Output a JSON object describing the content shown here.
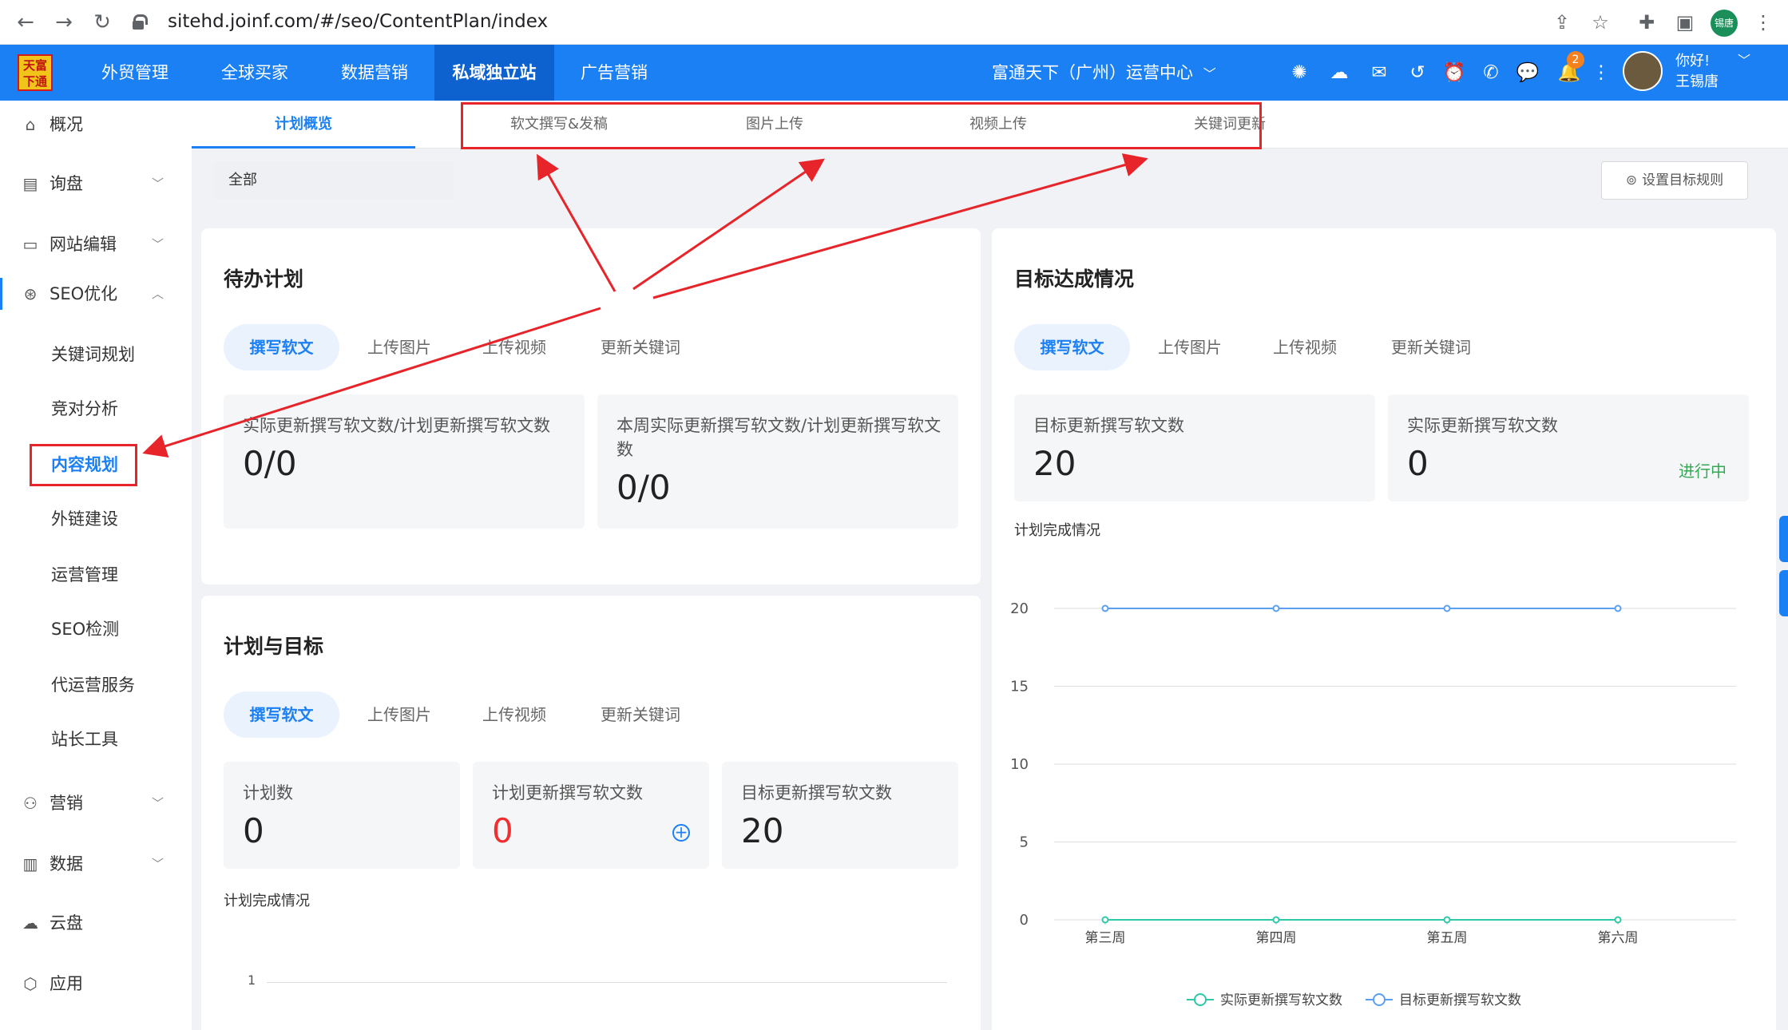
{
  "browser": {
    "url": "sitehd.joinf.com/#/seo/ContentPlan/index",
    "profile": "锡唐"
  },
  "header": {
    "logo_text": "天富下通",
    "nav": [
      "外贸管理",
      "全球买家",
      "数据营销",
      "私域独立站",
      "广告营销"
    ],
    "active_nav": "私域独立站",
    "org": "富通天下（广州）运营中心",
    "notification_count": "2",
    "greeting": "你好!",
    "user_name": "王锡唐"
  },
  "sidebar": {
    "items": [
      {
        "label": "概况",
        "icon": "home-icon"
      },
      {
        "label": "询盘",
        "icon": "clipboard-icon"
      },
      {
        "label": "网站编辑",
        "icon": "monitor-icon"
      },
      {
        "label": "SEO优化",
        "icon": "search-chart-icon"
      },
      {
        "label": "营销",
        "icon": "users-icon"
      },
      {
        "label": "数据",
        "icon": "bar-chart-icon"
      },
      {
        "label": "云盘",
        "icon": "cloud-icon"
      },
      {
        "label": "应用",
        "icon": "hexagon-icon"
      }
    ],
    "seo_sub": [
      "关键词规划",
      "竞对分析",
      "内容规划",
      "外链建设",
      "运营管理",
      "SEO检测",
      "代运营服务",
      "站长工具"
    ],
    "active_sub": "内容规划"
  },
  "sub_tabs": [
    "计划概览",
    "软文撰写&发稿",
    "图片上传",
    "视频上传",
    "关键词更新"
  ],
  "active_sub_tab": "计划概览",
  "filter": {
    "value": "全部"
  },
  "rule_button": "设置目标规则",
  "pending_plan": {
    "title": "待办计划",
    "tabs": [
      "撰写软文",
      "上传图片",
      "上传视频",
      "更新关键词"
    ],
    "stats": [
      {
        "label": "实际更新撰写软文数/计划更新撰写软文数",
        "value": "0/0"
      },
      {
        "label": "本周实际更新撰写软文数/计划更新撰写软文数",
        "value": "0/0"
      }
    ]
  },
  "plan_target": {
    "title": "计划与目标",
    "tabs": [
      "撰写软文",
      "上传图片",
      "上传视频",
      "更新关键词"
    ],
    "stats": [
      {
        "label": "计划数",
        "value": "0"
      },
      {
        "label": "计划更新撰写软文数",
        "value": "0"
      },
      {
        "label": "目标更新撰写软文数",
        "value": "20"
      }
    ],
    "chart_caption": "计划完成情况",
    "y_tick": "1"
  },
  "goal_status": {
    "title": "目标达成情况",
    "tabs": [
      "撰写软文",
      "上传图片",
      "上传视频",
      "更新关键词"
    ],
    "stats": [
      {
        "label": "目标更新撰写软文数",
        "value": "20"
      },
      {
        "label": "实际更新撰写软文数",
        "value": "0"
      }
    ],
    "status": "进行中",
    "chart_caption": "计划完成情况"
  },
  "chart_data": {
    "type": "line",
    "categories": [
      "第三周",
      "第四周",
      "第五周",
      "第六周"
    ],
    "y_ticks": [
      0,
      5,
      10,
      15,
      20
    ],
    "ylim": [
      0,
      20
    ],
    "grid": true,
    "legend_position": "bottom",
    "series": [
      {
        "name": "实际更新撰写软文数",
        "values": [
          0,
          0,
          0,
          0
        ],
        "color": "#2ec7a8"
      },
      {
        "name": "目标更新撰写软文数",
        "values": [
          20,
          20,
          20,
          20
        ],
        "color": "#5b9ff0"
      }
    ]
  },
  "colors": {
    "brand": "#1c80f5",
    "annotation": "#e8242b",
    "success": "#34a853",
    "danger": "#f03030"
  }
}
